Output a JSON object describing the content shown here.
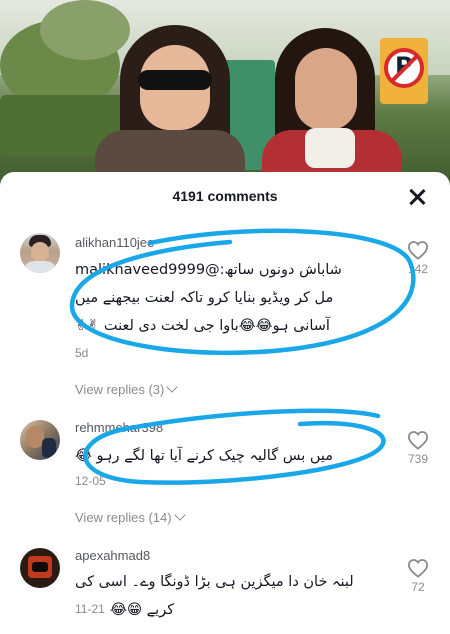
{
  "sheet": {
    "title": "4191 comments"
  },
  "comments": [
    {
      "username": "alikhan110jee",
      "lines": [
        "شاباش دونوں ساتھ:@malikhaveed9999",
        "مل کر ویڈیو بنایا کرو تاکہ لعنت بیجھنے میں",
        "آسانی ہو😂😂باوا جی لخت دی لعنت ✌✌"
      ],
      "date": "5d",
      "likes": "142",
      "replies": "View replies (3)"
    },
    {
      "username": "rehmmehar398",
      "lines": [
        "میں بس گالیہ چیک کرنے آیا تھا لگے رہو 😂"
      ],
      "date": "12-05",
      "likes": "739",
      "replies": "View replies (14)"
    },
    {
      "username": "apexahmad8",
      "lines": [
        "لبنہ خان دا میگزین ہی بڑا ڈونگا وے۔ اسی کی",
        "کریے 😁😂"
      ],
      "date": "11-21",
      "likes": "72"
    }
  ],
  "colors": {
    "highlight": "#1aa7e8",
    "text": "#161823",
    "muted": "#8a8b91"
  }
}
